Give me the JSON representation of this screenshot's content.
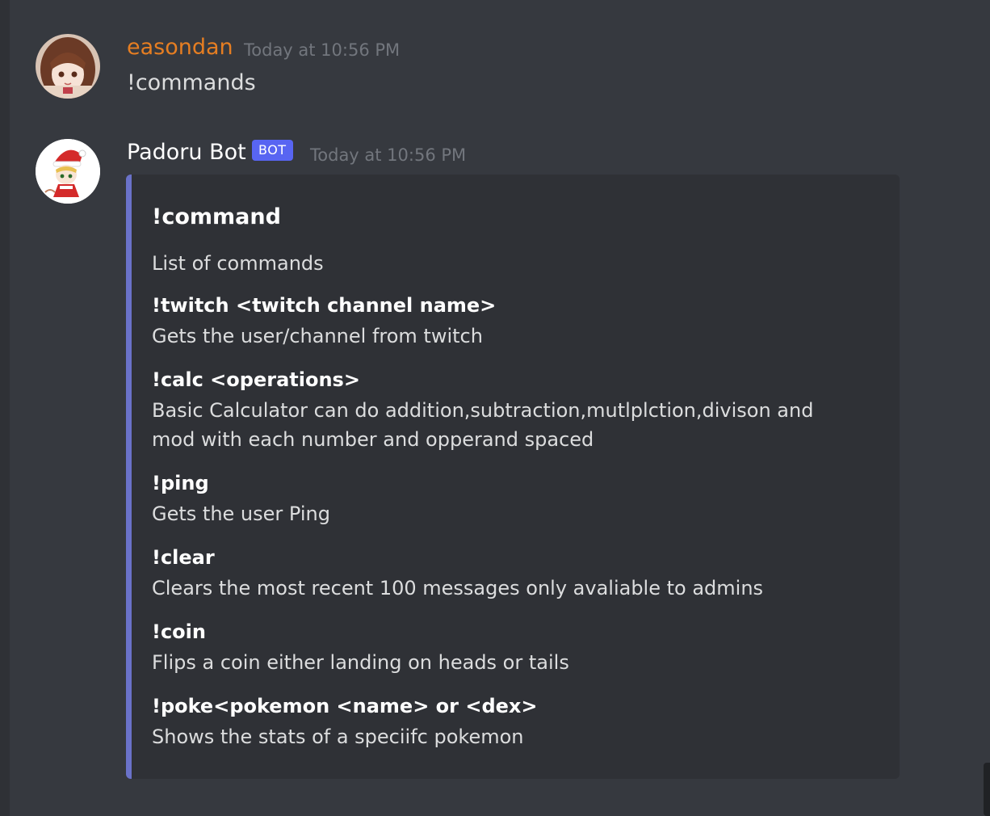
{
  "messages": [
    {
      "author": "easondan",
      "author_color": "#e67e22",
      "timestamp": "Today at 10:56 PM",
      "content": "!commands",
      "avatar_icon": "anime-girl-avatar"
    },
    {
      "author": "Padoru Bot",
      "author_color": "#ffffff",
      "bot_tag": "BOT",
      "timestamp": "Today at 10:56 PM",
      "avatar_icon": "padoru-avatar",
      "embed": {
        "accent_color": "#6a72c9",
        "title": "!command",
        "description": "List of commands",
        "fields": [
          {
            "name": "!twitch <twitch channel name>",
            "value": "Gets the user/channel from twitch"
          },
          {
            "name": "!calc <operations>",
            "value": "Basic Calculator can do addition,subtraction,mutlplction,divison and mod with each number and opperand spaced"
          },
          {
            "name": "!ping",
            "value": "Gets the user Ping"
          },
          {
            "name": "!clear",
            "value": "Clears the most recent 100 messages only avaliable to admins"
          },
          {
            "name": "!coin",
            "value": "Flips a coin either landing on heads or tails"
          },
          {
            "name": "!poke<pokemon <name> or <dex>",
            "value": "Shows the stats of a speciifc pokemon"
          }
        ]
      }
    }
  ]
}
